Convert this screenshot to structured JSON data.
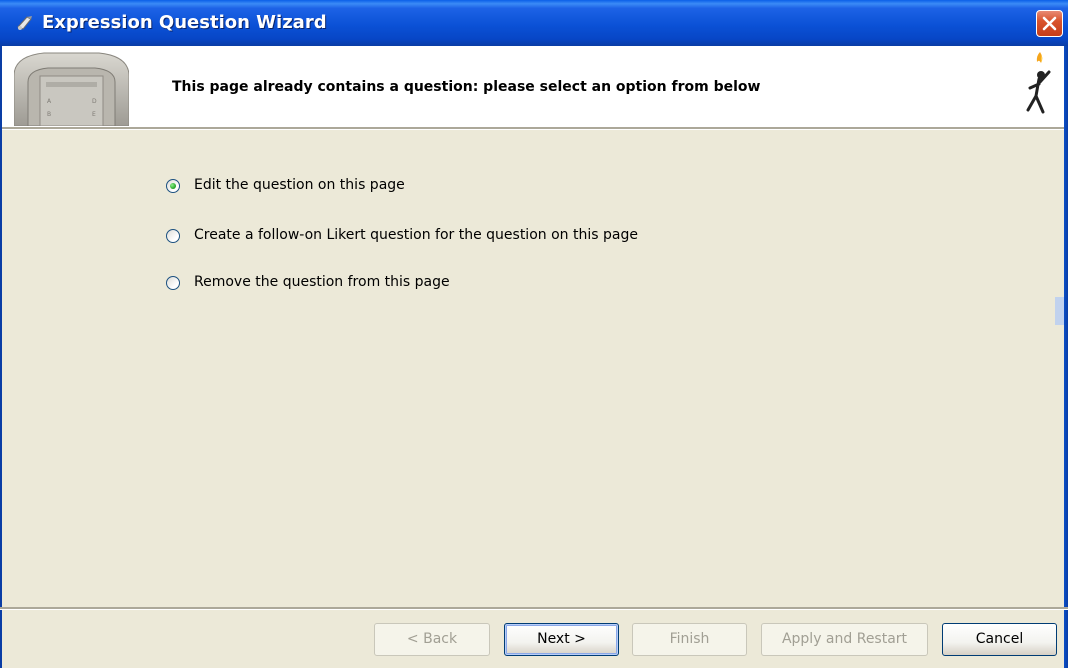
{
  "window": {
    "title": "Expression Question Wizard"
  },
  "header": {
    "instruction": "This page already contains a question: please select an option from below",
    "image_icon": "handset-device-image",
    "logo_icon": "torch-figure-logo"
  },
  "options": [
    {
      "label": "Edit the question on this page",
      "selected": true
    },
    {
      "label": "Create a follow-on Likert question for the question on this page",
      "selected": false
    },
    {
      "label": "Remove the question from this page",
      "selected": false
    }
  ],
  "buttons": {
    "back": {
      "label": "< Back",
      "enabled": false
    },
    "next": {
      "label": "Next >",
      "enabled": true
    },
    "finish": {
      "label": "Finish",
      "enabled": false
    },
    "apply_restart": {
      "label": "Apply and Restart",
      "enabled": false
    },
    "cancel": {
      "label": "Cancel",
      "enabled": true
    }
  },
  "colors": {
    "titlebar": "#0A5FE8",
    "dialog_background": "#ECE9D8",
    "header_background": "#FFFFFF",
    "close_button": "#D9542D"
  }
}
